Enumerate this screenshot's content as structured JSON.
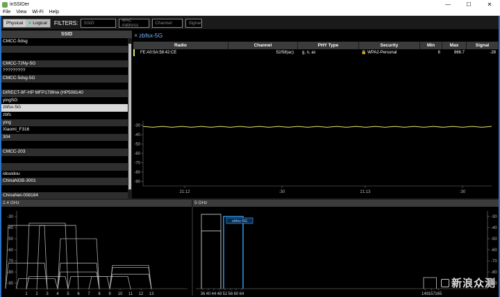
{
  "window": {
    "title": "inSSIDer",
    "min": "—",
    "max": "☐",
    "close": "✕"
  },
  "menu": [
    "File",
    "View",
    "Wi-Fi",
    "Help"
  ],
  "filters": {
    "physical": "Physical",
    "logical": "Logical",
    "label": "FILTERS:",
    "ssid_placeholder": "SSID",
    "mac_placeholder": "MAC Address",
    "channel_placeholder": "Channel",
    "signal_placeholder": "Signal"
  },
  "ssid_list": {
    "header": "SSID",
    "rows": [
      {
        "name": "CMCC-5dsg",
        "style": "normal"
      },
      {
        "name": "",
        "style": "alt"
      },
      {
        "name": "",
        "style": "normal"
      },
      {
        "name": "CMCC-7JNy-5G",
        "style": "alt"
      },
      {
        "name": "?????????",
        "style": "normal"
      },
      {
        "name": "CMCC-5dsg-5G",
        "style": "alt"
      },
      {
        "name": "",
        "style": "normal"
      },
      {
        "name": "DIRECT-9F-HP MFP179fnw (HP508140",
        "style": "alt"
      },
      {
        "name": "yingSG",
        "style": "normal"
      },
      {
        "name": "zbfsx-5G",
        "style": "sel"
      },
      {
        "name": "zbfs",
        "style": "normal"
      },
      {
        "name": "ying",
        "style": "alt"
      },
      {
        "name": "Xiaomi_F316",
        "style": "normal"
      },
      {
        "name": "304",
        "style": "alt"
      },
      {
        "name": "",
        "style": "normal"
      },
      {
        "name": "CMCC-203",
        "style": "alt"
      },
      {
        "name": "",
        "style": "normal"
      },
      {
        "name": "",
        "style": "alt"
      },
      {
        "name": "idouidou",
        "style": "normal"
      },
      {
        "name": "ChinaNGB-3001",
        "style": "alt"
      },
      {
        "name": "",
        "style": "normal"
      },
      {
        "name": "ChinaNet-008184",
        "style": "alt"
      }
    ]
  },
  "detail": {
    "title": "zbfsx-5G",
    "columns": [
      "Radio",
      "Channel",
      "PHY Type",
      "Security",
      "Min",
      "Max",
      "Signal"
    ],
    "row": {
      "radio": "FE:A0:5A:58:42:CE",
      "channel": "52/58(ac)",
      "phy": "g, n, ac",
      "security": "WPA2-Personal",
      "min": "6",
      "max": "866.7",
      "signal": "-28"
    },
    "y_ticks": [
      "-30",
      "-40",
      "-50",
      "-60",
      "-70",
      "-80",
      "-90"
    ],
    "x_ticks": [
      "21:12",
      ":30",
      "21:13",
      ":30"
    ]
  },
  "colors": {
    "signal_line": "#e8e86a",
    "selected_5g": "#2e8fe0",
    "network_outline": "#cccccc",
    "accent_frame": "#2a74c9"
  },
  "chart_data": [
    {
      "type": "line",
      "title": "",
      "xlabel": "",
      "ylabel": "",
      "ylim": [
        -95,
        -25
      ],
      "x_ticks": [
        "21:12",
        ":30",
        "21:13",
        ":30"
      ],
      "series": [
        {
          "name": "zbfsx-5G",
          "values": [
            -31,
            -32,
            -31,
            -32,
            -31,
            -32,
            -31,
            -32,
            -31,
            -32,
            -31,
            -32,
            -31,
            -32,
            -31,
            -32,
            -31,
            -32,
            -31,
            -32,
            -31,
            -32,
            -31,
            -32,
            -31,
            -32,
            -31,
            -32,
            -31,
            -32,
            -31,
            -32,
            -31,
            -32,
            -31,
            -32,
            -31
          ]
        }
      ]
    },
    {
      "type": "area",
      "title": "2.4 GHz",
      "y_ticks": [
        "-30",
        "-40",
        "-50",
        "-60",
        "-70",
        "-80",
        "-90"
      ],
      "x_ticks": [
        "1",
        "2",
        "3",
        "4",
        "5",
        "6",
        "7",
        "8",
        "9",
        "10",
        "11",
        "12",
        "13"
      ],
      "ylim": [
        -95,
        -25
      ],
      "networks": [
        {
          "center": 1,
          "width": 4,
          "signal": -38
        },
        {
          "center": 3,
          "width": 4,
          "signal": -36
        },
        {
          "center": 4,
          "width": 4,
          "signal": -38
        },
        {
          "center": 1,
          "width": 4,
          "signal": -72
        },
        {
          "center": 6,
          "width": 4,
          "signal": -50
        },
        {
          "center": 6,
          "width": 4,
          "signal": -72
        },
        {
          "center": 6,
          "width": 4,
          "signal": -80
        },
        {
          "center": 11,
          "width": 4,
          "signal": -74
        },
        {
          "center": 11,
          "width": 4,
          "signal": -76
        },
        {
          "center": 11,
          "width": 4,
          "signal": -82
        },
        {
          "center": 3,
          "width": 4,
          "signal": -84
        },
        {
          "center": 7,
          "width": 4,
          "signal": -84
        },
        {
          "center": 9,
          "width": 4,
          "signal": -84
        },
        {
          "center": 2,
          "width": 4,
          "signal": -86
        }
      ]
    },
    {
      "type": "area",
      "title": "5 GHz",
      "y_ticks": [
        "-30",
        "-40",
        "-50",
        "-60",
        "-70",
        "-80",
        "-90"
      ],
      "x_ticks": [
        "36",
        "40",
        "44",
        "48",
        "52",
        "56",
        "60",
        "64",
        "149",
        "157",
        "165"
      ],
      "ylim": [
        -95,
        -25
      ],
      "selected_label": "zbfsx-5G",
      "networks": [
        {
          "start": 36,
          "end": 48,
          "signal": -28,
          "selected": false
        },
        {
          "start": 36,
          "end": 48,
          "signal": -43,
          "selected": false
        },
        {
          "start": 52,
          "end": 64,
          "signal": -30,
          "selected": true
        },
        {
          "start": 149,
          "end": 161,
          "signal": -85,
          "selected": false
        }
      ]
    }
  ],
  "bottom": {
    "label_24": "2.4 GHz",
    "label_5": "5 GHz"
  },
  "watermark": "新浪众测"
}
